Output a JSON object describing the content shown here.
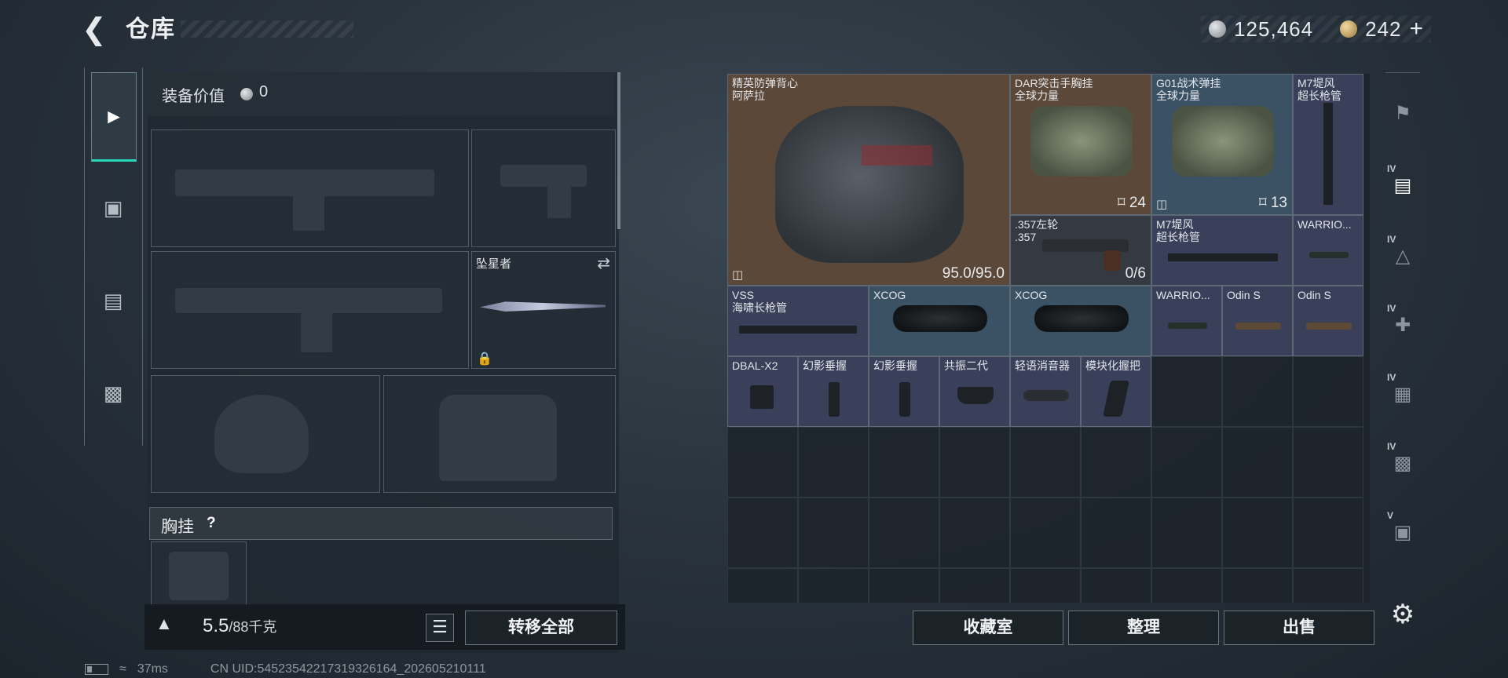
{
  "header": {
    "title": "仓库",
    "currency_silver": "125,464",
    "currency_gold": "242",
    "plus": "+"
  },
  "equipment": {
    "value_label": "装备价值",
    "value": "0",
    "knife_label": "坠星者",
    "chest_label": "胸挂",
    "chest_help": "?"
  },
  "weight": {
    "current": "5.5",
    "max_unit": "/88千克"
  },
  "buttons": {
    "transfer_all": "转移全部",
    "collection": "收藏室",
    "sort": "整理",
    "sell": "出售"
  },
  "status": {
    "ping": "37ms",
    "uid": "CN UID:54523542217319326164_202605210111"
  },
  "items": [
    {
      "name": "精英防弹背心\n阿萨拉",
      "value": "95.0/95.0",
      "color": "#5b4838"
    },
    {
      "name": "DAR突击手胸挂\n全球力量",
      "value": "24",
      "color": "#5b4838"
    },
    {
      "name": "G01战术弹挂\n全球力量",
      "value": "13",
      "color": "#3b5164"
    },
    {
      "name": "M7堤风\n超长枪管",
      "value": "",
      "color": "#3a3f5a"
    },
    {
      "name": ".357左轮\n.357",
      "value": "0/6",
      "color": "#353a42"
    },
    {
      "name": "M7堤风\n超长枪管",
      "value": "",
      "color": "#3a3f5a"
    },
    {
      "name": "WARRIO...",
      "value": "",
      "color": "#3a3f5a"
    },
    {
      "name": "VSS\n海啸长枪管",
      "value": "",
      "color": "#3a3f5a"
    },
    {
      "name": "XCOG",
      "value": "",
      "color": "#3b5164"
    },
    {
      "name": "XCOG",
      "value": "",
      "color": "#3b5164"
    },
    {
      "name": "WARRIO...",
      "value": "",
      "color": "#3a3f5a"
    },
    {
      "name": "Odin S",
      "value": "",
      "color": "#3a3f5a"
    },
    {
      "name": "Odin S",
      "value": "",
      "color": "#3a3f5a"
    },
    {
      "name": "DBAL-X2",
      "value": "",
      "color": "#3a3f5a"
    },
    {
      "name": "幻影垂握",
      "value": "",
      "color": "#3a3f5a"
    },
    {
      "name": "幻影垂握",
      "value": "",
      "color": "#3a3f5a"
    },
    {
      "name": "共振二代",
      "value": "",
      "color": "#3a3f5a"
    },
    {
      "name": "轻语消音器",
      "value": "",
      "color": "#3a3f5a"
    },
    {
      "name": "模块化握把",
      "value": "",
      "color": "#3a3f5a"
    }
  ],
  "right_tabs": [
    {
      "level": "",
      "icon": "safe-box-icon"
    },
    {
      "level": "IV",
      "icon": "storage-box-icon"
    },
    {
      "level": "IV",
      "icon": "storage-box-icon"
    },
    {
      "level": "IV",
      "icon": "storage-box-icon"
    },
    {
      "level": "IV",
      "icon": "storage-box-icon"
    },
    {
      "level": "IV",
      "icon": "storage-box-icon"
    },
    {
      "level": "V",
      "icon": "storage-box-icon"
    }
  ],
  "colors": {
    "accent": "#29d6b8"
  }
}
